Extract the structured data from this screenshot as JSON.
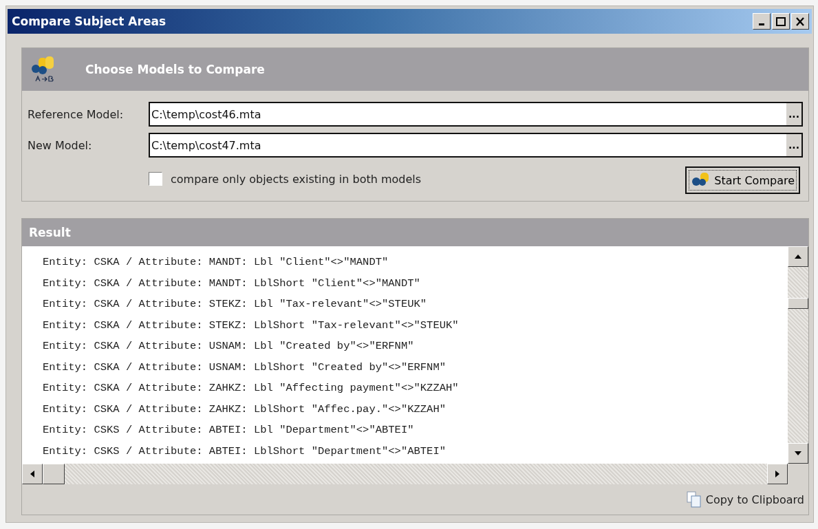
{
  "window": {
    "title": "Compare Subject Areas"
  },
  "models_panel": {
    "title": "Choose Models to Compare",
    "fields": [
      {
        "label": "Reference Model:",
        "value": "C:\\temp\\cost46.mta",
        "browse": "..."
      },
      {
        "label": "New Model:",
        "value": "C:\\temp\\cost47.mta",
        "browse": "..."
      }
    ],
    "option": {
      "label": "compare only objects existing in both models",
      "checked": false
    },
    "start_button": "Start Compare"
  },
  "result_panel": {
    "title": "Result",
    "lines": [
      "Entity: CSKA / Attribute: MANDT: Lbl \"Client\"<>\"MANDT\"",
      "Entity: CSKA / Attribute: MANDT: LblShort \"Client\"<>\"MANDT\"",
      "Entity: CSKA / Attribute: STEKZ: Lbl \"Tax-relevant\"<>\"STEUK\"",
      "Entity: CSKA / Attribute: STEKZ: LblShort \"Tax-relevant\"<>\"STEUK\"",
      "Entity: CSKA / Attribute: USNAM: Lbl \"Created by\"<>\"ERFNM\"",
      "Entity: CSKA / Attribute: USNAM: LblShort \"Created by\"<>\"ERFNM\"",
      "Entity: CSKA / Attribute: ZAHKZ: Lbl \"Affecting payment\"<>\"KZZAH\"",
      "Entity: CSKA / Attribute: ZAHKZ: LblShort \"Affec.pay.\"<>\"KZZAH\"",
      "Entity: CSKS / Attribute: ABTEI: Lbl \"Department\"<>\"ABTEI\"",
      "Entity: CSKS / Attribute: ABTEI: LblShort \"Department\"<>\"ABTEI\""
    ],
    "copy_button": "Copy to Clipboard"
  }
}
